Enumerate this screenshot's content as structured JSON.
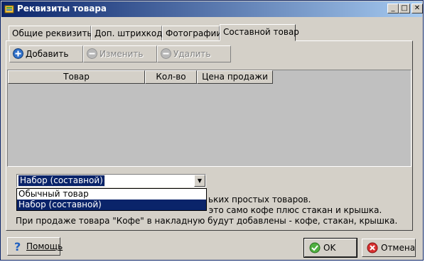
{
  "window": {
    "title": "Реквизиты товара"
  },
  "tabs": [
    {
      "label": "Общие реквизиты",
      "active": false
    },
    {
      "label": "Доп. штрихкода",
      "active": false
    },
    {
      "label": "Фотографии",
      "active": false
    },
    {
      "label": "Составной товар",
      "active": true
    }
  ],
  "toolbar": {
    "add_label": "Добавить",
    "edit_label": "Изменить",
    "delete_label": "Удалить"
  },
  "grid": {
    "columns": [
      "Товар",
      "Кол-во",
      "Цена продажи"
    ],
    "rows": []
  },
  "type_select": {
    "value": "Набор (составной)",
    "options": [
      "Обычный товар",
      "Набор (составной)"
    ],
    "selected_index": 1
  },
  "description": {
    "line1": "ьких простых товаров.",
    "line2": "Например, в кофейне/баре товар \"Кофе\" - это само кофе плюс стакан и крышка.",
    "line3": "При продаже товара \"Кофе\" в накладную будут добавлены - кофе, стакан, крышка."
  },
  "buttons": {
    "help": "Помощь",
    "ok": "OK",
    "cancel": "Отмена"
  },
  "colors": {
    "titlebar": "#0a246a",
    "face": "#d4d0c8",
    "selection": "#0a246a",
    "grid_bg": "#c0c0c0"
  }
}
